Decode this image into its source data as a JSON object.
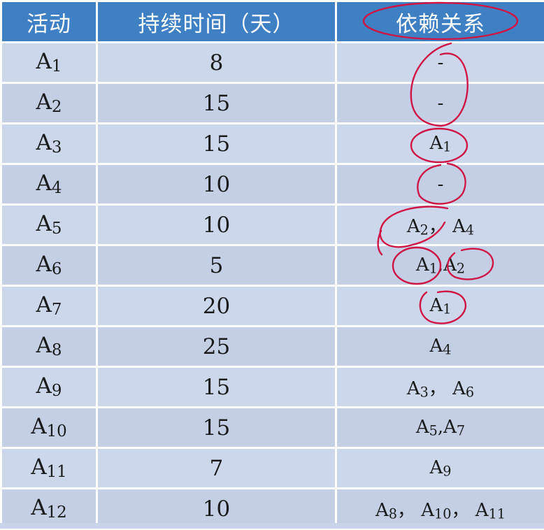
{
  "table": {
    "headers": {
      "activity": "活动",
      "duration": "持续时间（天）",
      "dependency": "依赖关系"
    },
    "rows": [
      {
        "id_letter": "A",
        "id_num": "1",
        "duration": "8",
        "deps": [
          {
            "text": "-"
          }
        ]
      },
      {
        "id_letter": "A",
        "id_num": "2",
        "duration": "15",
        "deps": [
          {
            "text": "-"
          }
        ]
      },
      {
        "id_letter": "A",
        "id_num": "3",
        "duration": "15",
        "deps": [
          {
            "text": "A",
            "sub": "1"
          }
        ]
      },
      {
        "id_letter": "A",
        "id_num": "4",
        "duration": "10",
        "deps": [
          {
            "text": "-"
          }
        ]
      },
      {
        "id_letter": "A",
        "id_num": "5",
        "duration": "10",
        "deps": [
          {
            "text": "A",
            "sub": "2"
          },
          {
            "text": "， "
          },
          {
            "text": "A",
            "sub": "4"
          }
        ]
      },
      {
        "id_letter": "A",
        "id_num": "6",
        "duration": "5",
        "deps": [
          {
            "text": "A",
            "sub": "1"
          },
          {
            "text": ","
          },
          {
            "text": "A",
            "sub": "2"
          }
        ]
      },
      {
        "id_letter": "A",
        "id_num": "7",
        "duration": "20",
        "deps": [
          {
            "text": "A",
            "sub": "1"
          }
        ]
      },
      {
        "id_letter": "A",
        "id_num": "8",
        "duration": "25",
        "deps": [
          {
            "text": "A",
            "sub": "4"
          }
        ]
      },
      {
        "id_letter": "A",
        "id_num": "9",
        "duration": "15",
        "deps": [
          {
            "text": "A",
            "sub": "3"
          },
          {
            "text": "， "
          },
          {
            "text": "A",
            "sub": "6"
          }
        ]
      },
      {
        "id_letter": "A",
        "id_num": "10",
        "duration": "15",
        "deps": [
          {
            "text": "A",
            "sub": "5"
          },
          {
            "text": ","
          },
          {
            "text": "A",
            "sub": "7"
          }
        ]
      },
      {
        "id_letter": "A",
        "id_num": "11",
        "duration": "7",
        "deps": [
          {
            "text": "A",
            "sub": "9"
          }
        ]
      },
      {
        "id_letter": "A",
        "id_num": "12",
        "duration": "10",
        "deps": [
          {
            "text": "A",
            "sub": "8"
          },
          {
            "text": "， "
          },
          {
            "text": "A",
            "sub": "10"
          },
          {
            "text": "， "
          },
          {
            "text": "A",
            "sub": "11"
          }
        ]
      }
    ]
  },
  "colors": {
    "header_bg": "#3e80c3",
    "row_bg": "#c9d4ea",
    "annotation": "#d01544"
  }
}
